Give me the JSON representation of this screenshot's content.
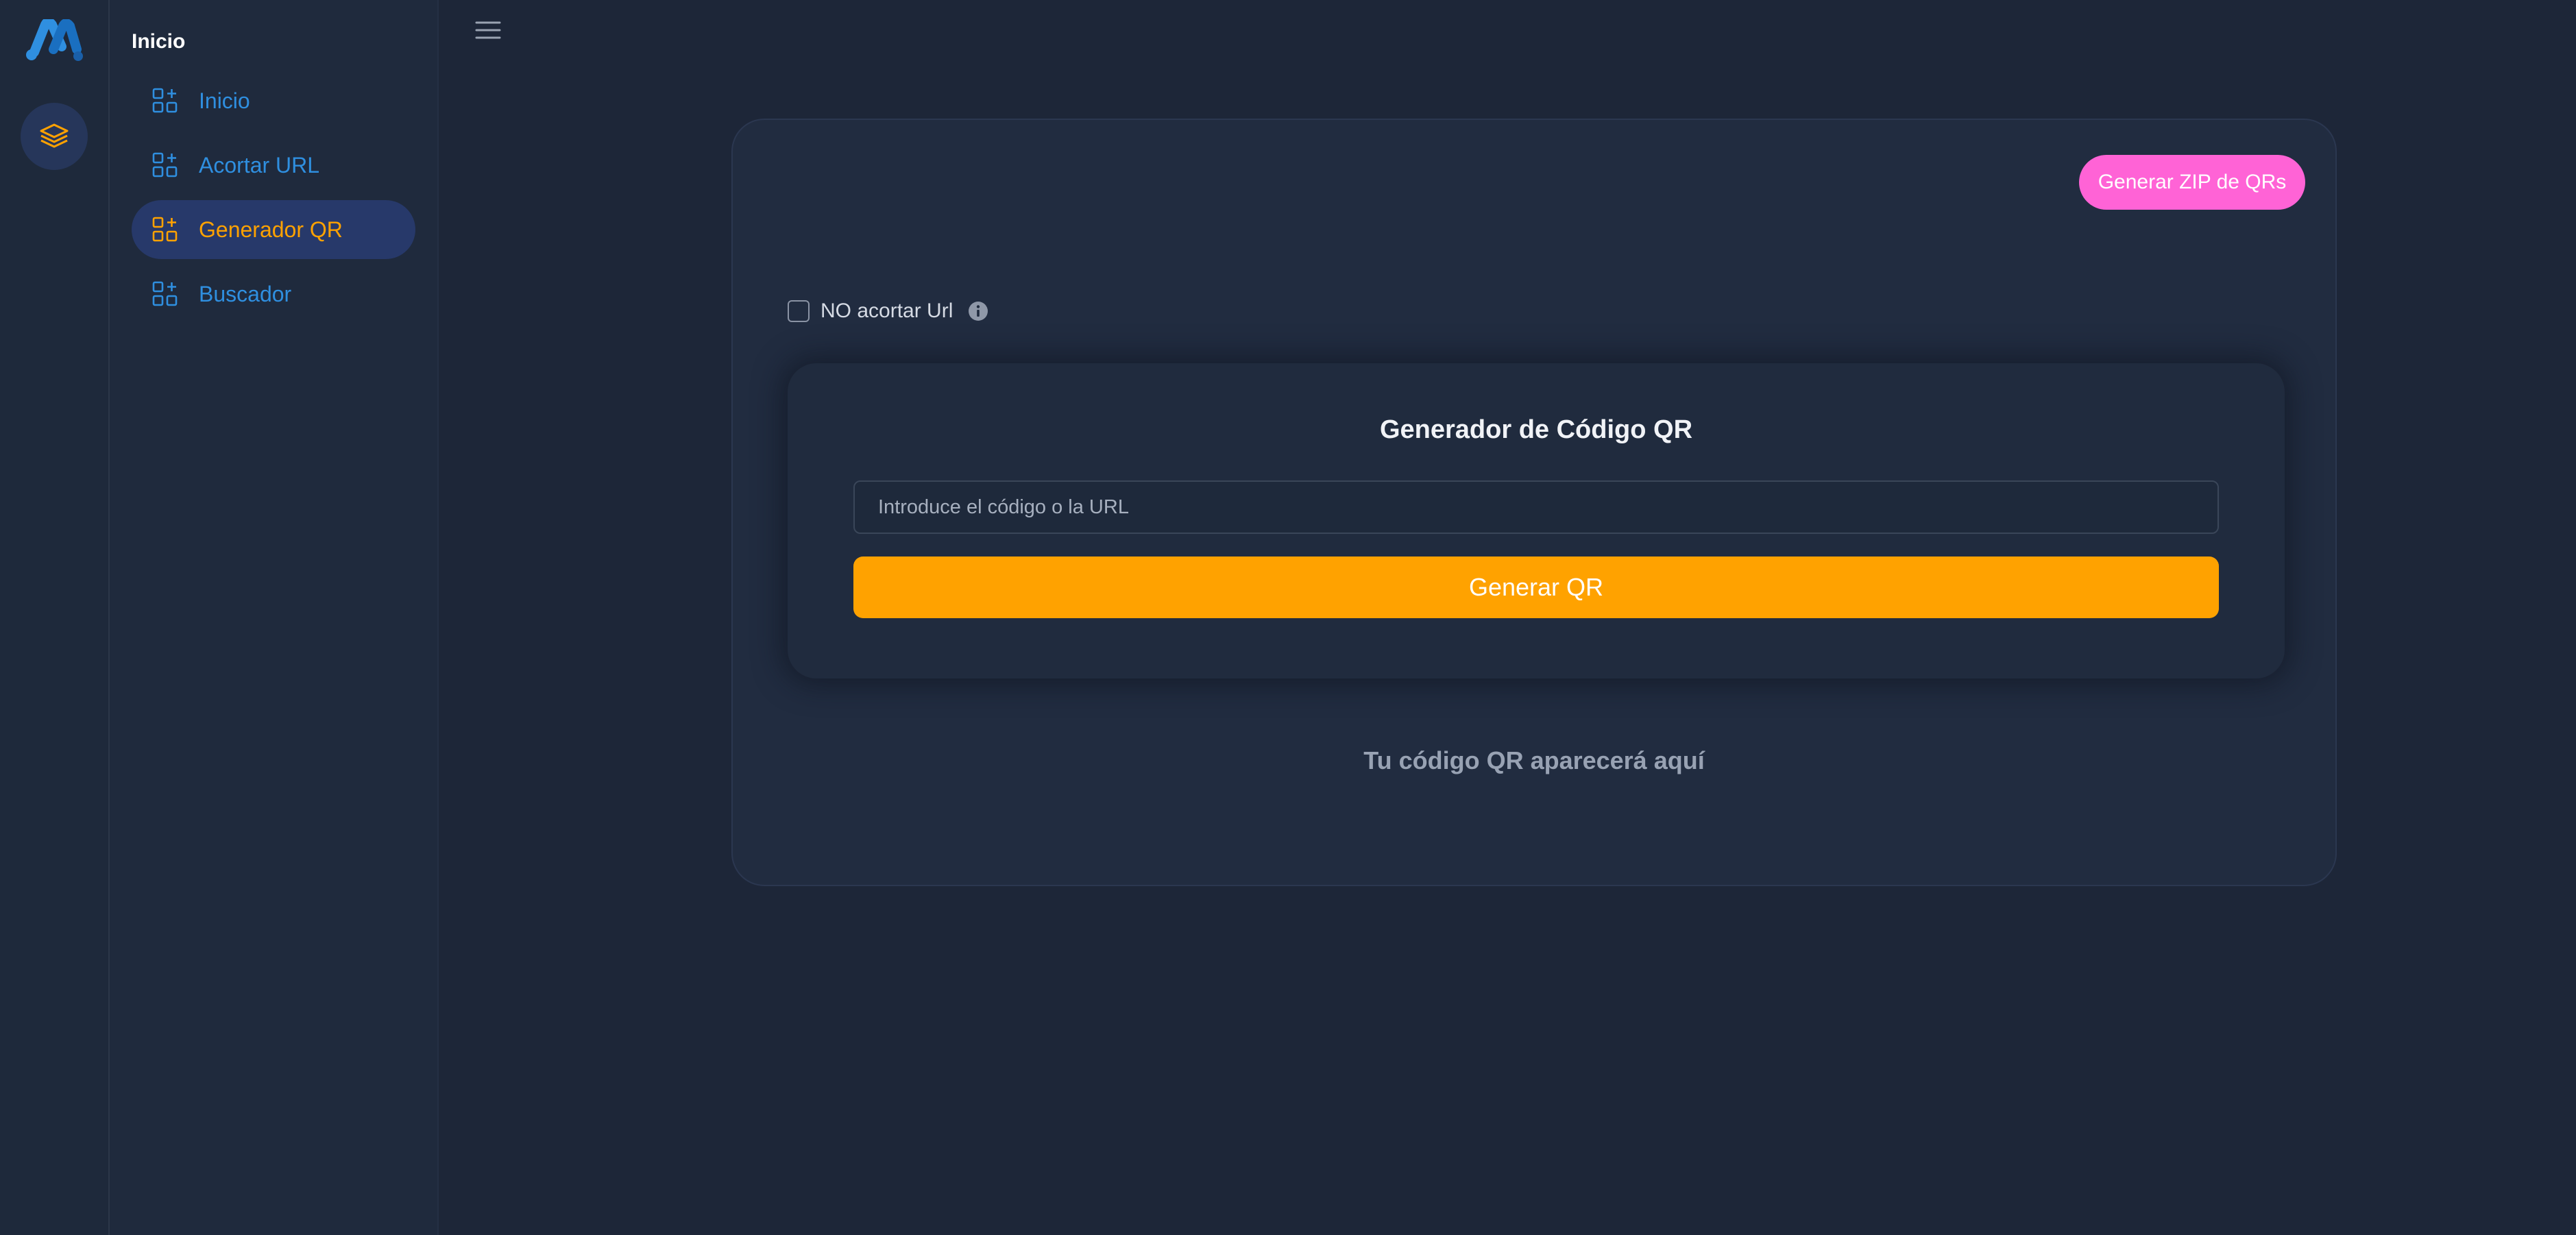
{
  "colors": {
    "background": "#1d2638",
    "accent_orange": "#ffa200",
    "accent_pink": "#ff63d6",
    "link_blue": "#2f8fe0",
    "active_item_bg": "#27396a"
  },
  "rail": {
    "logo_icon": "brand-logo-icon",
    "button_icon": "layers-icon"
  },
  "sidebar": {
    "title": "Inicio",
    "items": [
      {
        "label": "Inicio",
        "icon": "apps-add-icon",
        "active": false
      },
      {
        "label": "Acortar URL",
        "icon": "apps-add-icon",
        "active": false
      },
      {
        "label": "Generador QR",
        "icon": "apps-add-icon",
        "active": true
      },
      {
        "label": "Buscador",
        "icon": "apps-add-icon",
        "active": false
      }
    ]
  },
  "header": {
    "menu_icon": "hamburger-menu-icon"
  },
  "main": {
    "zip_button_label": "Generar ZIP de QRs",
    "no_shorten_label": "NO acortar Url",
    "no_shorten_checked": false,
    "info_icon": "info-icon",
    "qr_title": "Generador de Código QR",
    "input_placeholder": "Introduce el código o la URL",
    "input_value": "",
    "generate_label": "Generar QR",
    "result_placeholder": "Tu código QR aparecerá aquí"
  }
}
